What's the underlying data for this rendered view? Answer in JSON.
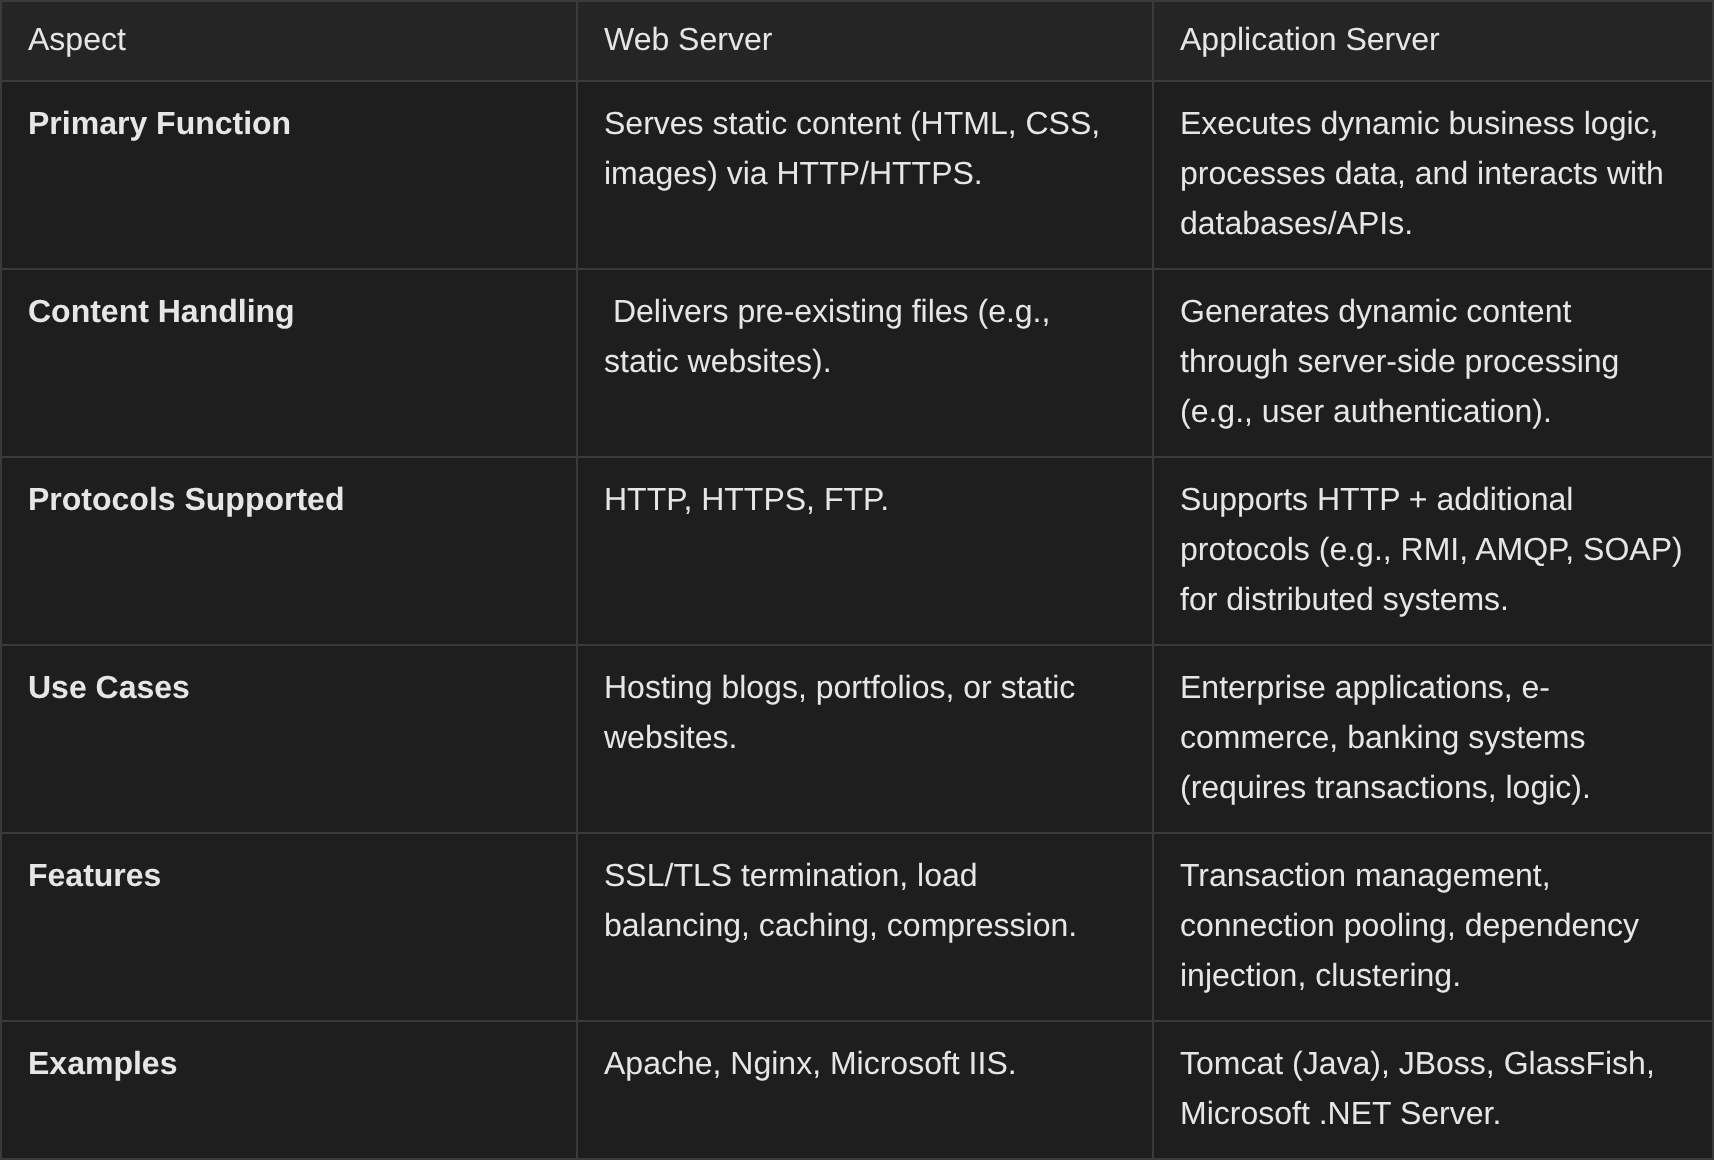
{
  "table": {
    "columns": [
      "Aspect",
      "Web Server",
      "Application Server"
    ],
    "rows": [
      [
        "Primary Function",
        "Serves static content (HTML, CSS, images) via HTTP/HTTPS.",
        "Executes dynamic business logic, processes data, and interacts with databases/APIs."
      ],
      [
        "Content Handling",
        " Delivers pre-existing files (e.g., static websites).",
        "Generates dynamic content through server-side processing (e.g., user authentication)."
      ],
      [
        "Protocols Supported",
        "HTTP, HTTPS, FTP.",
        "Supports HTTP + additional protocols (e.g., RMI, AMQP, SOAP) for distributed systems."
      ],
      [
        "Use Cases",
        "Hosting blogs, portfolios, or static websites.",
        "Enterprise applications, e-commerce, banking systems (requires transactions, logic)."
      ],
      [
        "Features",
        "SSL/TLS termination, load balancing, caching, compression.",
        "Transaction management, connection pooling, dependency injection, clustering."
      ],
      [
        "Examples",
        "Apache, Nginx, Microsoft IIS.",
        "Tomcat (Java), JBoss, GlassFish, Microsoft .NET Server."
      ]
    ]
  }
}
